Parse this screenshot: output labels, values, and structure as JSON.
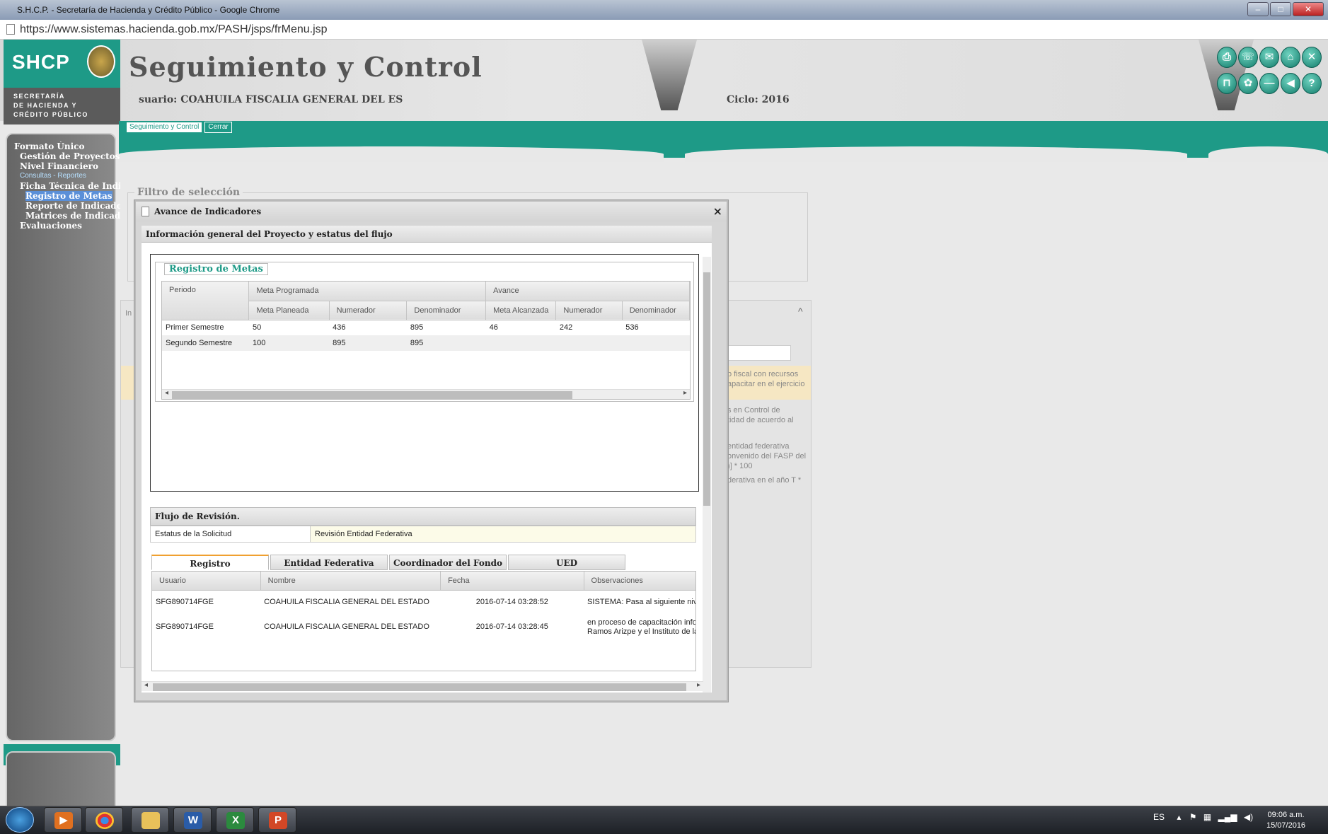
{
  "browser": {
    "title": "S.H.C.P. - Secretaría de Hacienda y Crédito Público - Google Chrome",
    "url": "https://www.sistemas.hacienda.gob.mx/PASH/jsps/frMenu.jsp"
  },
  "header": {
    "logo": "SHCP",
    "logo_sub_1": "SECRETARÍA",
    "logo_sub_2": "DE HACIENDA Y",
    "logo_sub_3": "CRÉDITO PÚBLICO",
    "app_title": "Seguimiento y Control",
    "usuario": "suario: COAHUILA FISCALIA GENERAL DEL ES",
    "ciclo": "Ciclo: 2016"
  },
  "nav_tabs": {
    "seguimiento": "Seguimiento y Control",
    "cerrar": "Cerrar"
  },
  "sidebar": {
    "formato": "Formato Único",
    "gestion": "Gestión de Proyectos",
    "nivel": "Nivel Financiero",
    "consultas": "Consultas - Reportes",
    "ficha": "Ficha Técnica de Indicadores",
    "registro": "Registro de Metas",
    "reporte": "Reporte de Indicadores",
    "matrices": "Matrices de Indicadores",
    "evaluaciones": "Evaluaciones"
  },
  "background": {
    "filtro": "Filtro de selección",
    "in": "In",
    "text1a": "o fiscal con recursos",
    "text1b": "apacitar en el ejercicio",
    "text2a": "s en Control de",
    "text2b": "tidad de acuerdo al",
    "text3a": "entidad federativa",
    "text3b": "onvenido del FASP del",
    "text3c": ")] * 100",
    "text4": "derativa en el año T *"
  },
  "modal": {
    "title": "Avance de Indicadores",
    "close": "×",
    "section": "Información general del Proyecto y estatus del flujo",
    "legend": "Registro de Metas",
    "headers": {
      "periodo": "Periodo",
      "meta_programada": "Meta Programada",
      "avance": "Avance",
      "meta_planeada": "Meta Planeada",
      "numerador": "Numerador",
      "denominador": "Denominador",
      "meta_alcanzada": "Meta Alcanzada",
      "numerador2": "Numerador",
      "denominador2": "Denominador"
    },
    "rows": [
      {
        "periodo": "Primer Semestre",
        "meta_planeada": "50",
        "numerador": "436",
        "denominador": "895",
        "meta_alcanzada": "46",
        "numerador2": "242",
        "denominador2": "536"
      },
      {
        "periodo": "Segundo Semestre",
        "meta_planeada": "100",
        "numerador": "895",
        "denominador": "895",
        "meta_alcanzada": "",
        "numerador2": "",
        "denominador2": ""
      }
    ],
    "flujo_title": "Flujo de Revisión.",
    "estatus_label": "Estatus de la Solicitud",
    "estatus_value": "Revisión Entidad Federativa",
    "flow_tabs": [
      "Registro",
      "Entidad Federativa",
      "Coordinador del Fondo",
      "UED"
    ],
    "flow_headers": {
      "usuario": "Usuario",
      "nombre": "Nombre",
      "fecha": "Fecha",
      "observaciones": "Observaciones"
    },
    "flow_rows": [
      {
        "usuario": "SFG890714FGE",
        "nombre": "COAHUILA FISCALIA GENERAL DEL ESTADO",
        "fecha": "2016-07-14 03:28:52",
        "observaciones": "SISTEMA: Pasa al siguiente nivel."
      },
      {
        "usuario": "SFG890714FGE",
        "nombre": "COAHUILA FISCALIA GENERAL DEL ESTADO",
        "fecha": "2016-07-14 03:28:45",
        "observaciones": "en proceso de capacitación información enviada por los insti ISESPE DE Ramos Arizpe y el Instituto de la PGJE"
      }
    ]
  },
  "taskbar": {
    "lang": "ES",
    "time": "09:06 a.m.",
    "date": "15/07/2016"
  },
  "colors": {
    "accent": "#1e9a87",
    "sidebar": "#6e6e6e",
    "highlight": "#f6e7c3"
  }
}
